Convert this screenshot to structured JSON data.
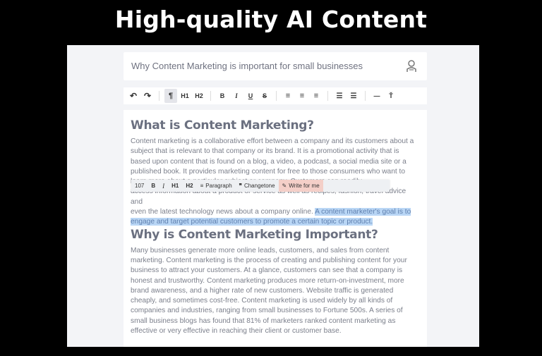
{
  "banner": {
    "title": "High-quality AI Content"
  },
  "title_bar": {
    "text": "Why Content Marketing is important for small businesses",
    "icon": "user-icon"
  },
  "toolbar": {
    "undo": "↶",
    "redo": "↷",
    "paragraph": "¶",
    "h1": "H1",
    "h2": "H2",
    "bold": "B",
    "italic": "I",
    "underline": "U",
    "strike": "S",
    "align_left": "≡",
    "align_center": "≡",
    "align_right": "≡",
    "bullet_list": "☰",
    "ordered_list": "☰",
    "hr": "—",
    "clear_format": "Ť"
  },
  "floating_toolbar": {
    "count": "107",
    "bold": "B",
    "italic": "I",
    "h1": "H1",
    "h2": "H2",
    "paragraph": "Paragraph",
    "changetone": "Changetone",
    "write_for_me": "Write for me"
  },
  "document": {
    "heading1": "What is Content Marketing?",
    "para1_lines": [
      "Content marketing is a collaborative effort between a company and its customers about a",
      "subject that is relevant to that company or its brand. It is a promotional activity that is",
      "based upon content that is found on a blog, a video, a podcast, a social media site or a",
      "published book. It provides marketing content for free to those consumers who want to",
      "learn more about a particular subject or company. Customers can readily",
      "access information about a product or service as well as recipes, fashion, travel advice and"
    ],
    "para1_line7": "even the latest technology news about a company online. ",
    "para1_highlight_a": "A content marketer's goal is to",
    "para1_highlight_b": "engage and target potential customers to promote a certain topic or product.",
    "heading2": "Why is Content Marketing Important?",
    "para2_lines": [
      "Many businesses generate more online leads, customers, and sales from content",
      "marketing. Content marketing is the process of creating and publishing content for your",
      "business to attract your customers. At a glance, customers can see that a company is",
      "honest and trustworthy. Content marketing produces more return-on-investment, more",
      "brand awareness, and a higher rate of new customers.  Website traffic is generated",
      "cheaply, and sometimes cost-free. Content marketing is used widely by all kinds of",
      "companies and industries, ranging from small businesses to Fortune 500s.  A series of",
      "small business blogs has found that 81% of marketers ranked content marketing as",
      "effective or very effective in reaching their client or customer base."
    ]
  }
}
